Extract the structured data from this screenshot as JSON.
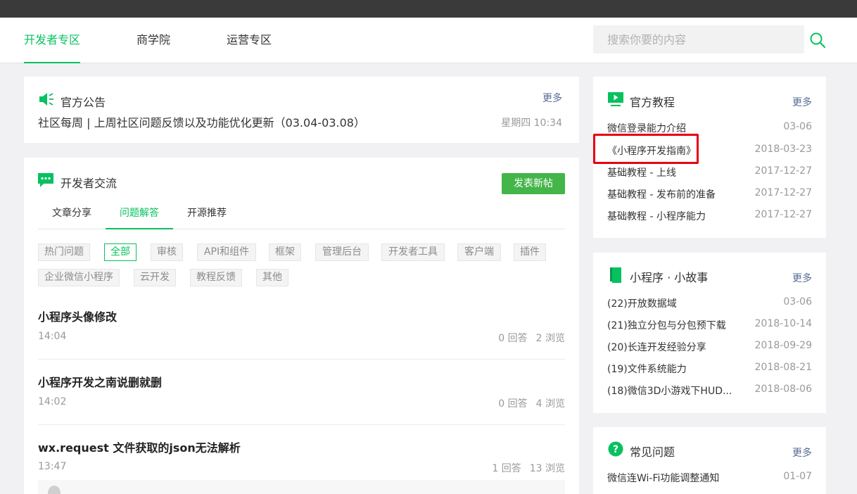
{
  "nav": {
    "tabs": [
      {
        "label": "开发者专区"
      },
      {
        "label": "商学院"
      },
      {
        "label": "运营专区"
      }
    ],
    "search_placeholder": "搜索你要的内容"
  },
  "announcement": {
    "title": "官方公告",
    "more": "更多",
    "text": "社区每周 | 上周社区问题反馈以及功能优化更新（03.04-03.08）",
    "time": "星期四 10:34"
  },
  "exchange": {
    "title": "开发者交流",
    "post_button": "发表新帖",
    "subtabs": [
      "文章分享",
      "问题解答",
      "开源推荐"
    ],
    "active_subtab": "问题解答",
    "tags": [
      "热门问题",
      "全部",
      "审核",
      "API和组件",
      "框架",
      "管理后台",
      "开发者工具",
      "客户端",
      "插件",
      "企业微信小程序",
      "云开发",
      "教程反馈",
      "其他"
    ],
    "active_tag": "全部",
    "posts": [
      {
        "title": "小程序头像修改",
        "time": "14:04",
        "replies": "0 回答",
        "views": "2 浏览"
      },
      {
        "title": "小程序开发之南说删就删",
        "time": "14:02",
        "replies": "0 回答",
        "views": "4 浏览"
      },
      {
        "title": "wx.request 文件获取的json无法解析",
        "time": "13:47",
        "replies": "1 回答",
        "views": "13 浏览"
      }
    ]
  },
  "tutorials": {
    "title": "官方教程",
    "more": "更多",
    "items": [
      {
        "title": "微信登录能力介绍",
        "date": "03-06"
      },
      {
        "title": "《小程序开发指南》",
        "date": "2018-03-23"
      },
      {
        "title": "基础教程 - 上线",
        "date": "2017-12-27"
      },
      {
        "title": "基础教程 - 发布前的准备",
        "date": "2017-12-27"
      },
      {
        "title": "基础教程 - 小程序能力",
        "date": "2017-12-27"
      }
    ]
  },
  "stories": {
    "title": "小程序 · 小故事",
    "more": "更多",
    "items": [
      {
        "title": "(22)开放数据域",
        "date": "03-06"
      },
      {
        "title": "(21)独立分包与分包预下载",
        "date": "2018-10-14"
      },
      {
        "title": "(20)长连开发经验分享",
        "date": "2018-09-29"
      },
      {
        "title": "(19)文件系统能力",
        "date": "2018-08-21"
      },
      {
        "title": "(18)微信3D小游戏下HUD...",
        "date": "2018-08-06"
      }
    ]
  },
  "faq": {
    "title": "常见问题",
    "more": "更多",
    "items": [
      {
        "title": "微信连Wi-Fi功能调整通知",
        "date": "01-07"
      }
    ]
  },
  "colors": {
    "accent": "#07c160",
    "button": "#44b549",
    "highlight": "#e60012"
  }
}
